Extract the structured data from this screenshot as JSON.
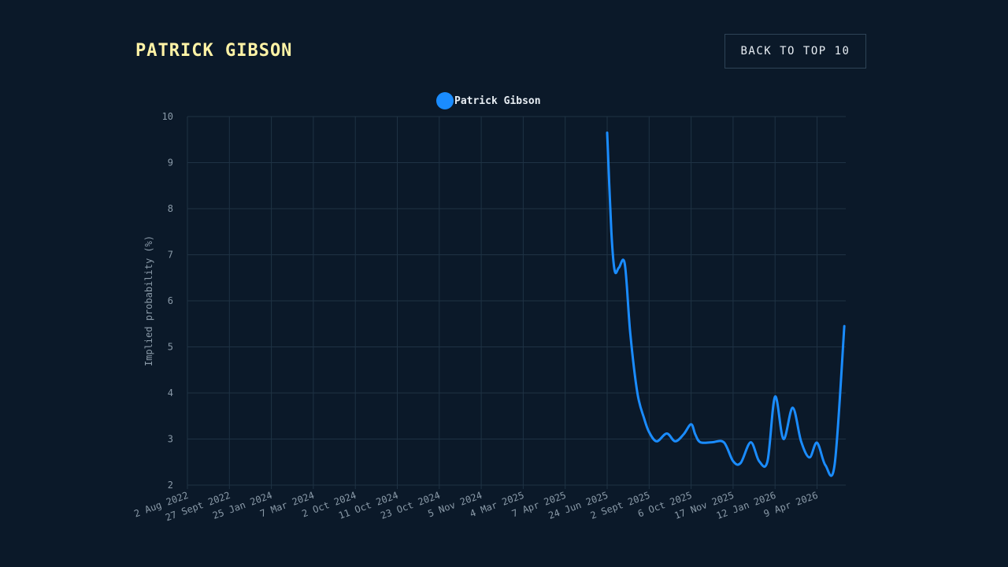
{
  "header": {
    "title": "PATRICK GIBSON",
    "back_button_label": "BACK TO TOP 10"
  },
  "colors": {
    "background": "#0b1929",
    "title": "#fff3a6",
    "series": "#1a8cff",
    "grid": "#1f3244",
    "tick_text": "#8a9aa8"
  },
  "chart_data": {
    "type": "line",
    "title": "",
    "xlabel": "",
    "ylabel": "Implied probability (%)",
    "ylim": [
      2,
      10
    ],
    "yticks": [
      2,
      3,
      4,
      5,
      6,
      7,
      8,
      9,
      10
    ],
    "grid": true,
    "legend": "top-center",
    "categories": [
      "2 Aug 2022",
      "27 Sept 2022",
      "25 Jan 2024",
      "7 Mar 2024",
      "2 Oct 2024",
      "11 Oct 2024",
      "23 Oct 2024",
      "5 Nov 2024",
      "4 Mar 2025",
      "7 Apr 2025",
      "24 Jun 2025",
      "2 Sept 2025",
      "6 Oct 2025",
      "17 Nov 2025",
      "12 Jan 2026",
      "9 Apr 2026"
    ],
    "series": [
      {
        "name": "Patrick Gibson",
        "points": [
          [
            10.0,
            9.65
          ],
          [
            10.1,
            7.5
          ],
          [
            10.18,
            6.65
          ],
          [
            10.28,
            6.72
          ],
          [
            10.42,
            6.8
          ],
          [
            10.55,
            5.3
          ],
          [
            10.72,
            4.0
          ],
          [
            10.88,
            3.45
          ],
          [
            11.0,
            3.15
          ],
          [
            11.18,
            2.95
          ],
          [
            11.42,
            3.12
          ],
          [
            11.62,
            2.95
          ],
          [
            11.82,
            3.1
          ],
          [
            12.0,
            3.32
          ],
          [
            12.1,
            3.1
          ],
          [
            12.22,
            2.93
          ],
          [
            12.5,
            2.93
          ],
          [
            12.78,
            2.93
          ],
          [
            13.0,
            2.52
          ],
          [
            13.18,
            2.48
          ],
          [
            13.42,
            2.93
          ],
          [
            13.62,
            2.52
          ],
          [
            13.82,
            2.52
          ],
          [
            14.0,
            3.92
          ],
          [
            14.2,
            3.0
          ],
          [
            14.42,
            3.68
          ],
          [
            14.62,
            2.95
          ],
          [
            14.82,
            2.6
          ],
          [
            15.0,
            2.92
          ],
          [
            15.2,
            2.43
          ],
          [
            15.42,
            2.45
          ],
          [
            15.65,
            5.45
          ]
        ]
      }
    ]
  }
}
